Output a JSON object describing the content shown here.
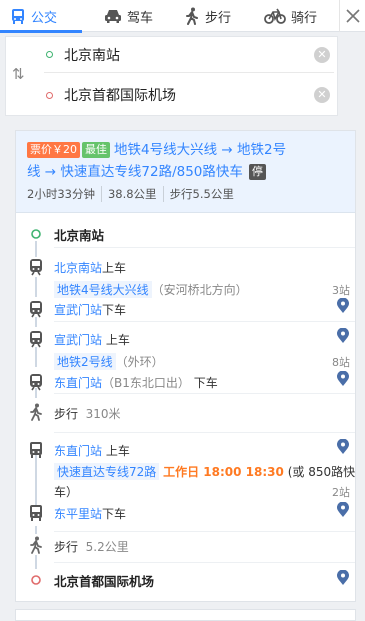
{
  "tabs": [
    {
      "label": "公交",
      "icon": "bus-icon",
      "active": true
    },
    {
      "label": "驾车",
      "icon": "car-icon"
    },
    {
      "label": "步行",
      "icon": "walk-icon"
    },
    {
      "label": "骑行",
      "icon": "bike-icon"
    }
  ],
  "route_form": {
    "start": "北京南站",
    "end": "北京首都国际机场"
  },
  "summary": {
    "price_badge": "票价￥20",
    "best_badge": "最佳",
    "route_part1": "地铁4号线大兴线 → 地铁2号",
    "route_part2": "线 → 快速直达专线72路/850路快车",
    "park_badge": "停",
    "duration": "2小时33分钟",
    "distance": "38.8公里",
    "walk": "步行5.5公里"
  },
  "steps": {
    "start_name": "北京南站",
    "s1_board_station": "北京南站",
    "s1_board_suffix": "上车",
    "s1_line": "地铁4号线大兴线",
    "s1_direction": "（安河桥北方向）",
    "s1_count": "3站",
    "s1_alight_station": "宣武门站",
    "s1_alight_suffix": "下车",
    "s2_board_station": "宣武门站",
    "s2_board_suffix": "上车",
    "s2_line": "地铁2号线",
    "s2_direction": "（外环）",
    "s2_count": "8站",
    "s2_alight_station": "东直门站",
    "s2_alight_exit": "（B1东北口出）",
    "s2_alight_suffix": "下车",
    "walk1_label": "步行",
    "walk1_dist": "310米",
    "s3_board_station": "东直门站",
    "s3_board_suffix": "上车",
    "s3_line": "快速直达专线72路",
    "s3_time": "工作日 18:00 18:30",
    "s3_alt": "(或 850路快",
    "s3_alt2": "车）",
    "s3_count": "2站",
    "s3_alight_station": "东平里站",
    "s3_alight_suffix": "下车",
    "walk2_label": "步行",
    "walk2_dist": "5.2公里",
    "end_name": "北京首都国际机场"
  },
  "colors": {
    "accent": "#3385ff",
    "price": "#ff7743",
    "best": "#65c36b",
    "time": "#ff7a22"
  }
}
